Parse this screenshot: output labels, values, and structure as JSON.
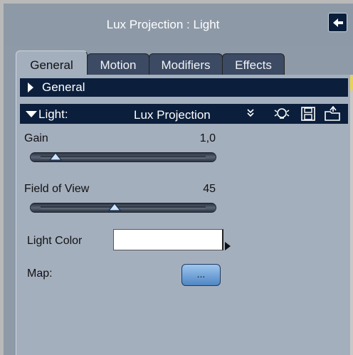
{
  "window": {
    "title": "Lux Projection : Light"
  },
  "tabs": [
    {
      "label": "General",
      "active": true
    },
    {
      "label": "Motion",
      "active": false
    },
    {
      "label": "Modifiers",
      "active": false
    },
    {
      "label": "Effects",
      "active": false
    }
  ],
  "sections": {
    "general": {
      "label": "General"
    },
    "light": {
      "label": "Light:",
      "type_value": "Lux Projection"
    }
  },
  "params": {
    "gain": {
      "label": "Gain",
      "value": "1,0",
      "slider_fraction": 0.09
    },
    "field_of_view": {
      "label": "Field of View",
      "value": "45",
      "slider_fraction": 0.45
    },
    "light_color": {
      "label": "Light Color",
      "color": "#ffffff"
    },
    "map": {
      "label": "Map:",
      "button_label": "..."
    }
  },
  "icons": {
    "collapse": "collapse-panel-icon",
    "menu": "double-chevron-down-icon",
    "preset": "lightbulb-icon",
    "save": "save-disk-icon",
    "load": "load-folder-icon"
  },
  "colors": {
    "panel_bg": "#a4afbe",
    "header_bg": "#0b1f3c",
    "title_text": "#ffffff",
    "button_blue": "#5f94cc"
  }
}
